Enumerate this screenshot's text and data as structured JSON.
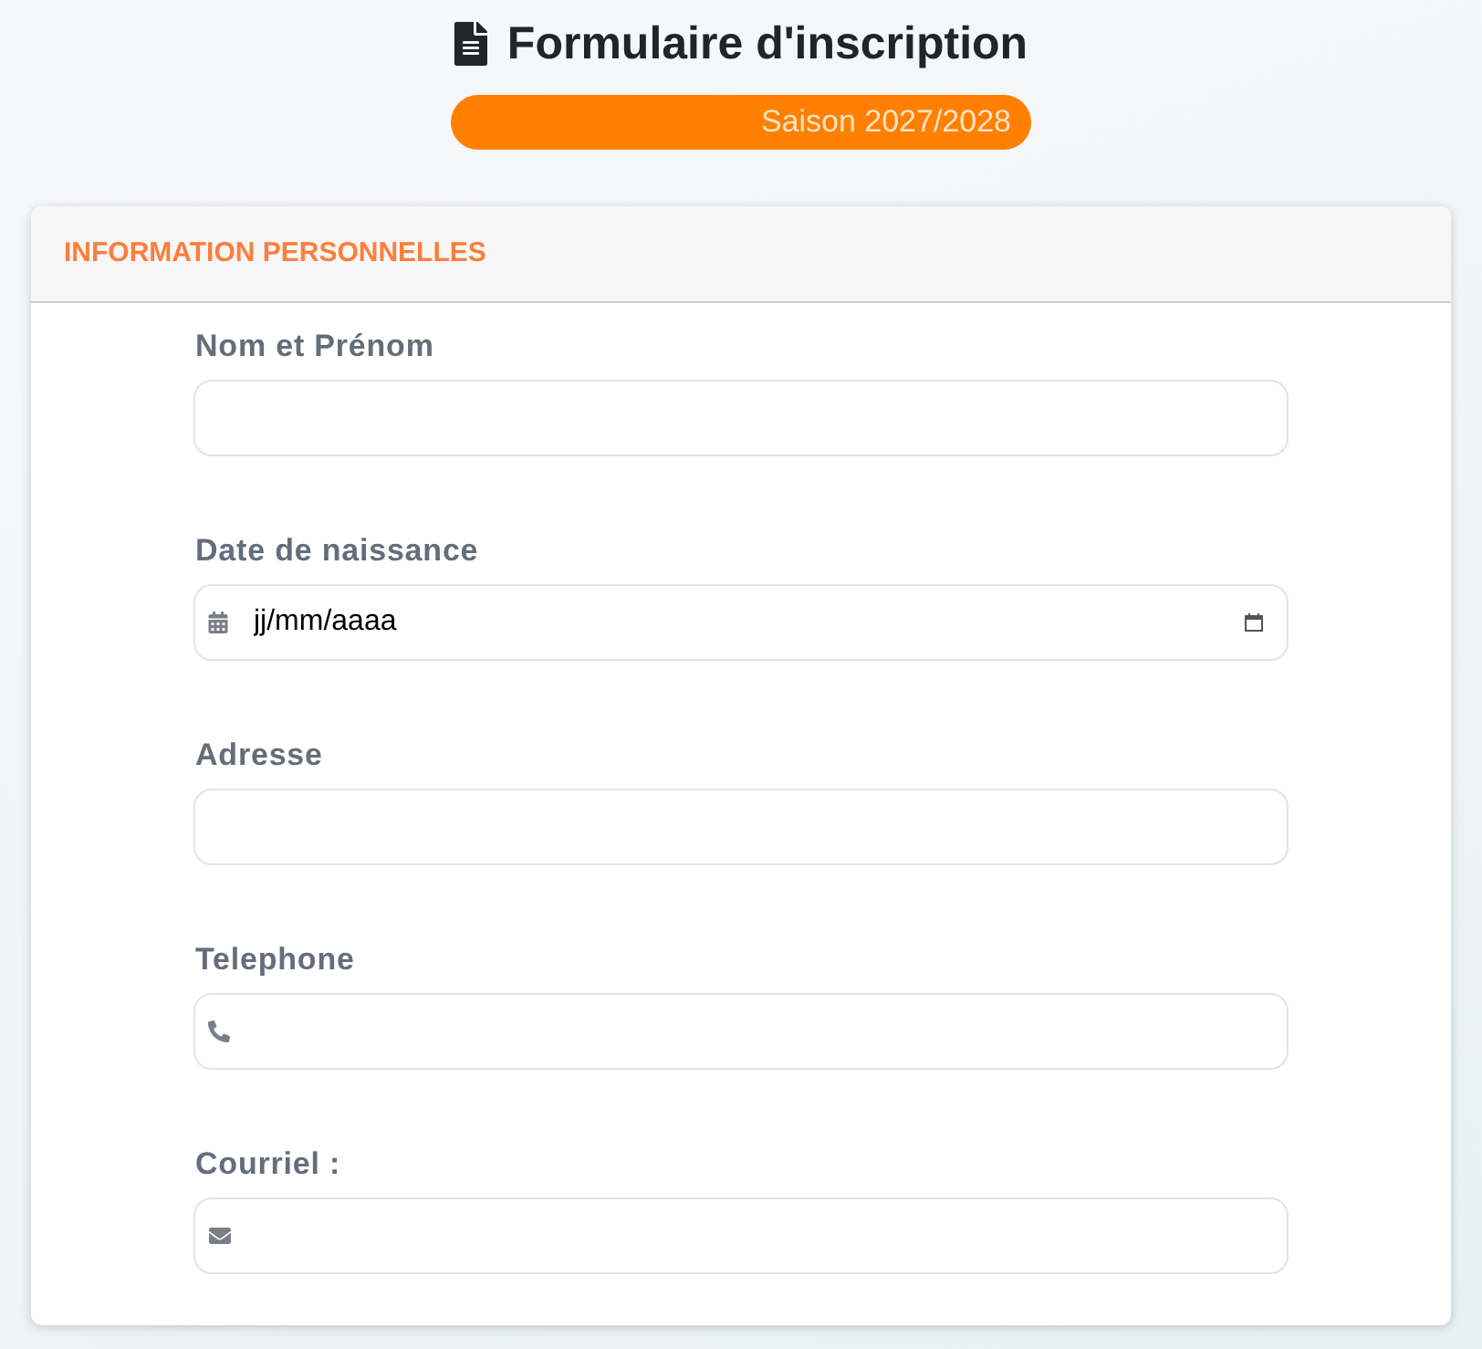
{
  "header": {
    "title": "Formulaire d'inscription",
    "season": "Saison 2027/2028"
  },
  "section": {
    "title": "INFORMATION PERSONNELLES",
    "fields": [
      {
        "label": "Nom et Prénom",
        "kind": "text"
      },
      {
        "label": "Date de naissance",
        "kind": "date",
        "placeholder": "jj/mm/aaaa"
      },
      {
        "label": "Adresse",
        "kind": "text"
      },
      {
        "label": "Telephone",
        "kind": "phone"
      },
      {
        "label": "Courriel :",
        "kind": "email"
      }
    ]
  }
}
